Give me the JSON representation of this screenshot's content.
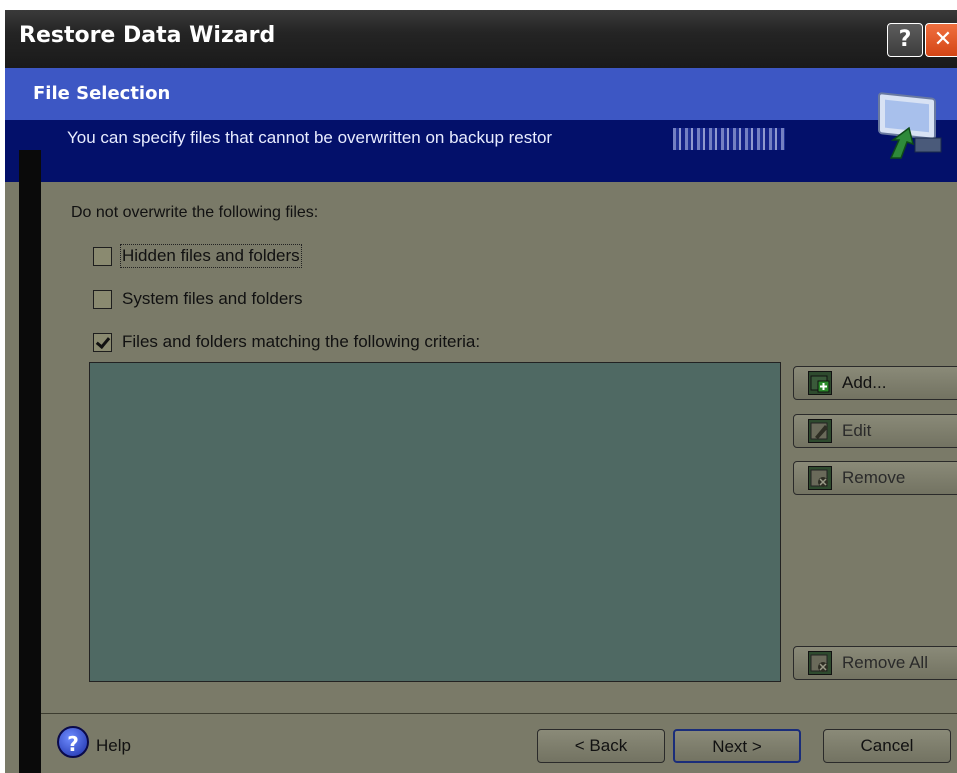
{
  "window": {
    "title": "Restore Data Wizard",
    "help_glyph": "?",
    "close_glyph": "✕"
  },
  "header": {
    "title": "File Selection",
    "subtitle": "You can specify files that cannot be overwritten on backup restor",
    "icon": "restore-monitor-icon"
  },
  "content": {
    "section_label": "Do not overwrite the following files:",
    "options": [
      {
        "label": "Hidden files and folders",
        "checked": false
      },
      {
        "label": "System files and folders",
        "checked": false
      },
      {
        "label": "Files and folders matching the following criteria:",
        "checked": true
      }
    ],
    "list_items": []
  },
  "side_buttons": {
    "add": "Add...",
    "edit": "Edit",
    "remove": "Remove",
    "remove_all": "Remove All"
  },
  "footer": {
    "help": "Help",
    "back": "< Back",
    "next": "Next >",
    "cancel": "Cancel"
  },
  "colors": {
    "header_blue": "#3d57c4",
    "header_dark": "#03106a",
    "window_bg": "#7a7a68",
    "list_bg": "#4f6963"
  }
}
